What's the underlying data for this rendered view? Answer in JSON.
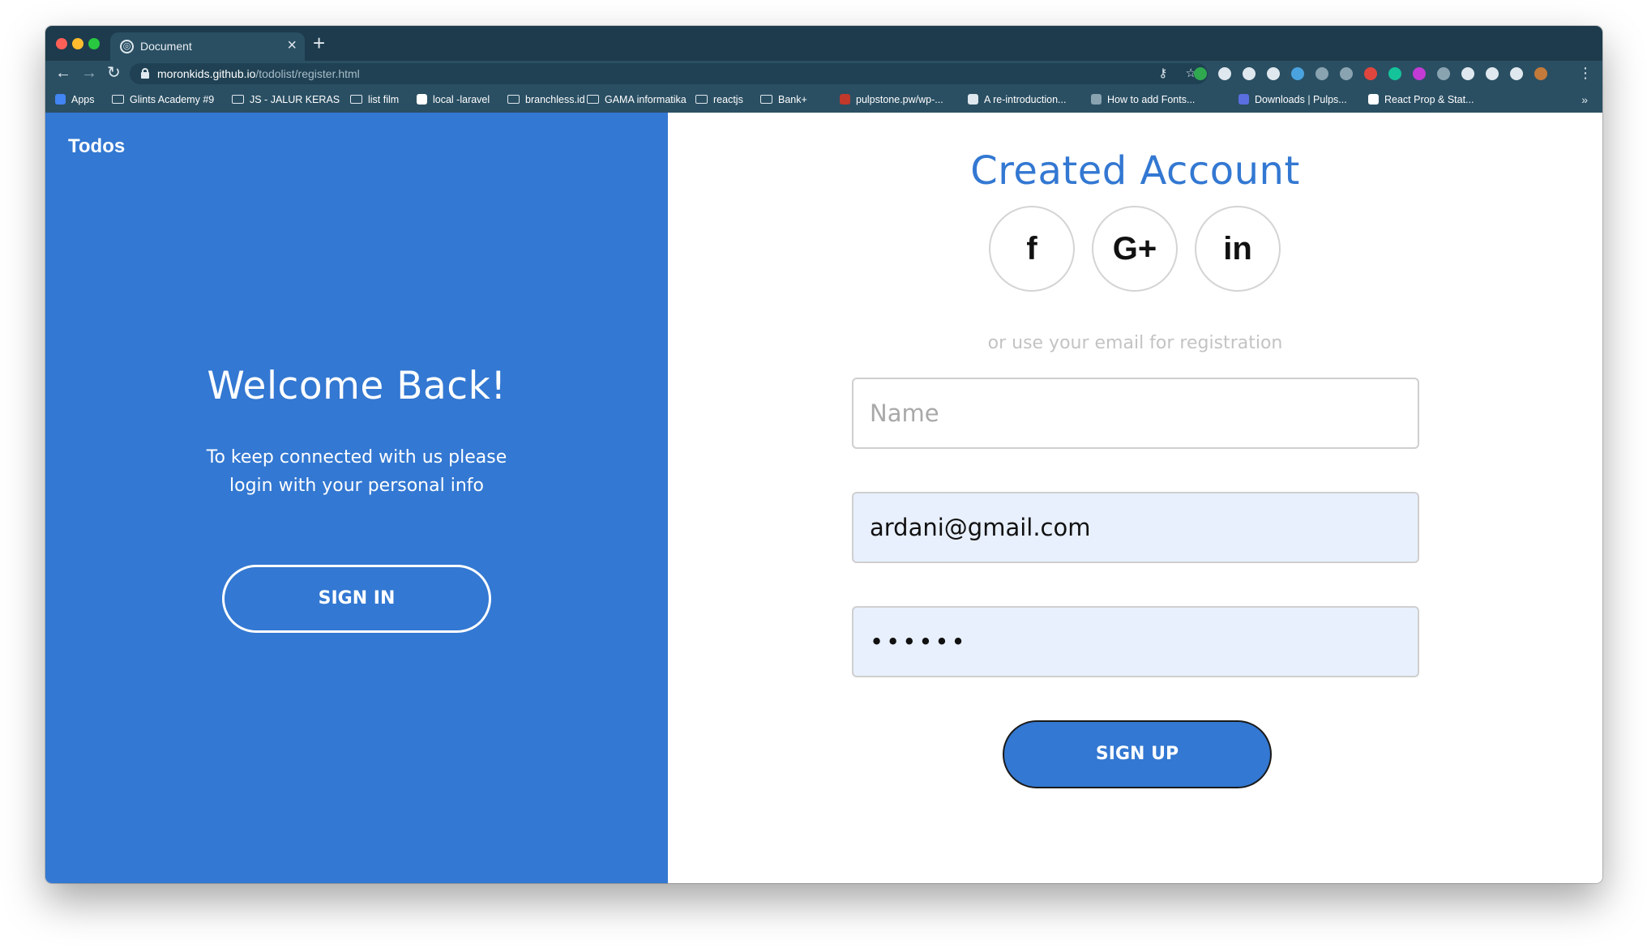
{
  "browser": {
    "tab_title": "Document",
    "tab_close": "×",
    "new_tab": "+",
    "url_host": "moronkids.github.io",
    "url_path": "/todolist/register.html",
    "nav_back": "←",
    "nav_forward": "→",
    "nav_reload": "↻",
    "key_icon": "⚷",
    "star_icon": "☆",
    "menu": "⋮",
    "bookmarks_more": "»",
    "bookmarks": [
      {
        "label": "Apps",
        "icon": "apps-grid-icon"
      },
      {
        "label": "Glints Academy #9",
        "icon": "folder-icon"
      },
      {
        "label": "JS - JALUR KERAS",
        "icon": "folder-icon"
      },
      {
        "label": "list film",
        "icon": "folder-icon"
      },
      {
        "label": "local -laravel",
        "icon": "page-icon"
      },
      {
        "label": "branchless.id",
        "icon": "folder-icon"
      },
      {
        "label": "GAMA informatika",
        "icon": "folder-icon"
      },
      {
        "label": "reactjs",
        "icon": "folder-icon"
      },
      {
        "label": "Bank+",
        "icon": "folder-icon"
      },
      {
        "label": "pulpstone.pw/wp-...",
        "icon": "pulpstone-icon"
      },
      {
        "label": "A re-introduction...",
        "icon": "mdn-icon"
      },
      {
        "label": "How to add Fonts...",
        "icon": "globe-icon"
      },
      {
        "label": "Downloads | Pulps...",
        "icon": "shield-icon"
      },
      {
        "label": "React Prop & Stat...",
        "icon": "medium-icon"
      }
    ],
    "extension_colors": [
      "#2fa84f",
      "#dfe8ee",
      "#dfe8ee",
      "#dfe8ee",
      "#4aa3df",
      "#8aa3b1",
      "#8aa3b1",
      "#e0463d",
      "#15c39a",
      "#c23bd4",
      "#8aa3b1",
      "#dfe8ee",
      "#dfe8ee",
      "#dfe8ee",
      "#c47a3a"
    ]
  },
  "left": {
    "brand": "Todos",
    "welcome": "Welcome Back!",
    "subtext": "To keep connected with us please login with your personal info",
    "signin_label": "SIGN IN"
  },
  "right": {
    "title": "Created Account",
    "social": {
      "facebook": "f",
      "google": "G+",
      "linkedin": "in"
    },
    "hint": "or use your email for registration",
    "name_placeholder": "Name",
    "name_value": "",
    "email_value": "ardani@gmail.com",
    "password_value": "••••••",
    "signup_label": "SIGN UP"
  },
  "colors": {
    "primary": "#3378d2",
    "browser_frame": "#1d3b4c",
    "autofill_bg": "#e8f0fe"
  }
}
